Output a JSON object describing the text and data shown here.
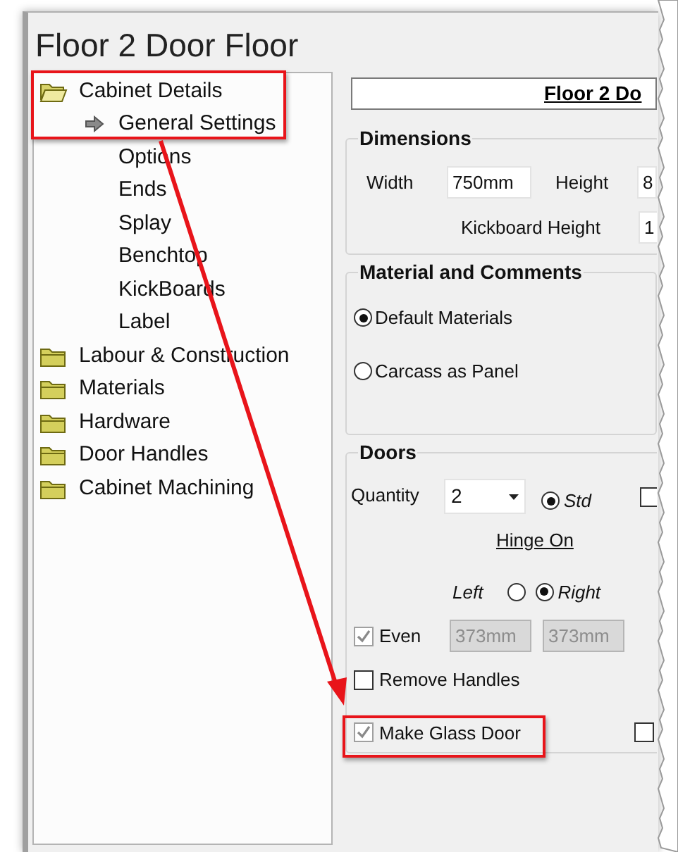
{
  "window": {
    "title": "Floor 2 Door Floor"
  },
  "tree": [
    {
      "label": "Cabinet Details",
      "expanded": true,
      "children": [
        {
          "label": "General Settings",
          "selected": true
        },
        {
          "label": "Options",
          "selected": false
        },
        {
          "label": "Ends",
          "selected": false
        },
        {
          "label": "Splay",
          "selected": false
        },
        {
          "label": "Benchtop",
          "selected": false
        },
        {
          "label": "KickBoards",
          "selected": false
        },
        {
          "label": "Label",
          "selected": false
        }
      ]
    },
    {
      "label": "Labour & Construction",
      "expanded": false
    },
    {
      "label": "Materials",
      "expanded": false
    },
    {
      "label": "Hardware",
      "expanded": false
    },
    {
      "label": "Door Handles",
      "expanded": false
    },
    {
      "label": "Cabinet Machining",
      "expanded": false
    }
  ],
  "header": {
    "text": "Floor 2 Do"
  },
  "dimensions": {
    "title": "Dimensions",
    "width": {
      "label": "Width",
      "value": "750mm"
    },
    "height": {
      "label": "Height",
      "value": "8"
    },
    "kickboard_height": {
      "label": "Kickboard Height",
      "value": "1"
    }
  },
  "material": {
    "title": "Material and Comments",
    "options": [
      {
        "label": "Default Materials",
        "selected": true
      },
      {
        "label": "Carcass as Panel",
        "selected": false
      }
    ]
  },
  "doors": {
    "title": "Doors",
    "quantity": {
      "label": "Quantity",
      "value": "2"
    },
    "style_option": {
      "label": "Std",
      "selected": true
    },
    "side_checkbox_top": {
      "checked": false
    },
    "hinge": {
      "label": "Hinge On",
      "options": [
        {
          "label": "Left",
          "selected": false
        },
        {
          "label": "Right",
          "selected": true
        }
      ]
    },
    "even": {
      "label": "Even",
      "checked": true,
      "disabled": true
    },
    "door_widths": [
      {
        "value": "373mm",
        "disabled": true
      },
      {
        "value": "373mm",
        "disabled": true
      }
    ],
    "remove_handles": {
      "label": "Remove Handles",
      "checked": false,
      "disabled": false
    },
    "glass_door": {
      "label": "Make Glass Door",
      "checked": true,
      "disabled": true
    },
    "side_checkbox_bottom": {
      "checked": false
    }
  }
}
